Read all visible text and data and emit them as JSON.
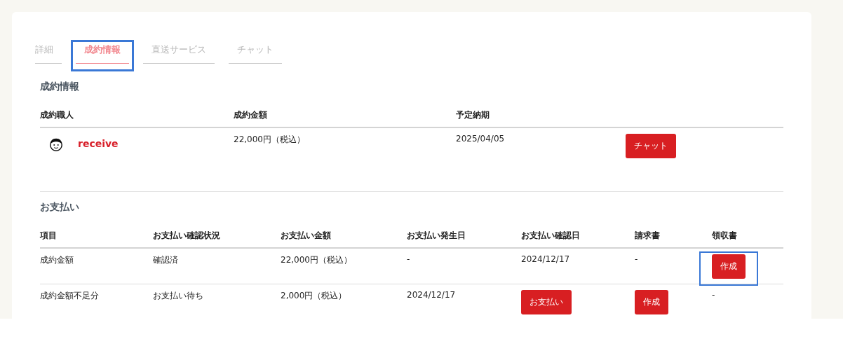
{
  "tabs": [
    {
      "label": "詳細",
      "selected": false,
      "highlighted": false
    },
    {
      "label": "成約情報",
      "selected": true,
      "highlighted": true
    },
    {
      "label": "直送サービス",
      "selected": false,
      "highlighted": false
    },
    {
      "label": "チャット",
      "selected": false,
      "highlighted": false
    }
  ],
  "contract": {
    "title": "成約情報",
    "columns": [
      "成約職人",
      "成約金額",
      "予定納期",
      ""
    ],
    "rows": [
      {
        "cells": [
          {
            "kind": "avatar",
            "text": "receive"
          },
          {
            "kind": "text",
            "text": "22,000円（税込）"
          },
          {
            "kind": "text",
            "text": "2025/04/05"
          },
          {
            "kind": "button",
            "text": "チャット",
            "highlighted": false
          }
        ]
      }
    ]
  },
  "payments": {
    "title": "お支払い",
    "columns": [
      "項目",
      "お支払い確認状況",
      "お支払い金額",
      "お支払い発生日",
      "お支払い確認日",
      "請求書",
      "領収書"
    ],
    "rows": [
      {
        "cells": [
          {
            "kind": "text",
            "text": "成約金額"
          },
          {
            "kind": "text",
            "text": "確認済"
          },
          {
            "kind": "text",
            "text": "22,000円（税込）"
          },
          {
            "kind": "text",
            "text": "-"
          },
          {
            "kind": "text",
            "text": "2024/12/17"
          },
          {
            "kind": "text",
            "text": "-"
          },
          {
            "kind": "button",
            "text": "作成",
            "highlighted": true
          }
        ]
      },
      {
        "cells": [
          {
            "kind": "text",
            "text": "成約金額不足分"
          },
          {
            "kind": "text",
            "text": "お支払い待ち"
          },
          {
            "kind": "text",
            "text": "2,000円（税込）"
          },
          {
            "kind": "text",
            "text": "2024/12/17"
          },
          {
            "kind": "button",
            "text": "お支払い",
            "highlighted": false
          },
          {
            "kind": "button",
            "text": "作成",
            "highlighted": false
          },
          {
            "kind": "text",
            "text": "-"
          }
        ]
      }
    ]
  }
}
